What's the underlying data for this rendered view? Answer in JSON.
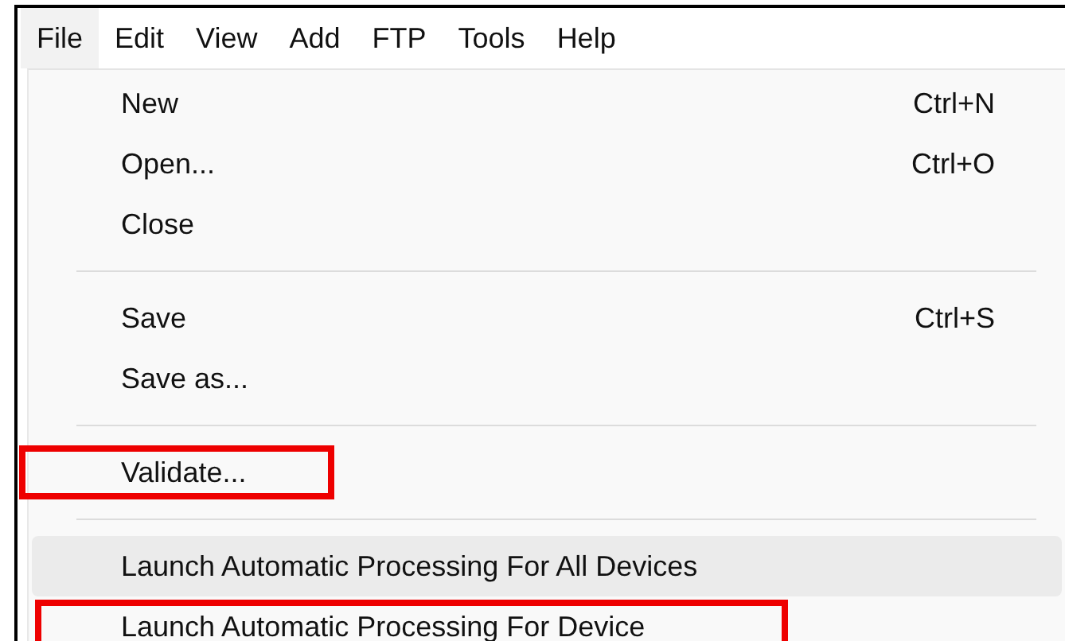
{
  "menu_bar": [
    {
      "label": "File",
      "selected": true
    },
    {
      "label": "Edit",
      "selected": false
    },
    {
      "label": "View",
      "selected": false
    },
    {
      "label": "Add",
      "selected": false
    },
    {
      "label": "FTP",
      "selected": false
    },
    {
      "label": "Tools",
      "selected": false
    },
    {
      "label": "Help",
      "selected": false
    }
  ],
  "file_menu": [
    {
      "kind": "item",
      "label": "New",
      "shortcut": "Ctrl+N",
      "hovered": false,
      "annotated": false
    },
    {
      "kind": "item",
      "label": "Open...",
      "shortcut": "Ctrl+O",
      "hovered": false,
      "annotated": false
    },
    {
      "kind": "item",
      "label": "Close",
      "hovered": false,
      "annotated": false
    },
    {
      "kind": "separator"
    },
    {
      "kind": "item",
      "label": "Save",
      "shortcut": "Ctrl+S",
      "hovered": false,
      "annotated": false
    },
    {
      "kind": "item",
      "label": "Save as...",
      "hovered": false,
      "annotated": false
    },
    {
      "kind": "separator"
    },
    {
      "kind": "item",
      "label": "Validate...",
      "hovered": false,
      "annotated": true
    },
    {
      "kind": "separator"
    },
    {
      "kind": "item",
      "label": "Launch Automatic Processing For All Devices",
      "hovered": true,
      "annotated": false
    },
    {
      "kind": "item",
      "label": "Launch Automatic Processing For Device",
      "hovered": false,
      "annotated": true
    }
  ]
}
